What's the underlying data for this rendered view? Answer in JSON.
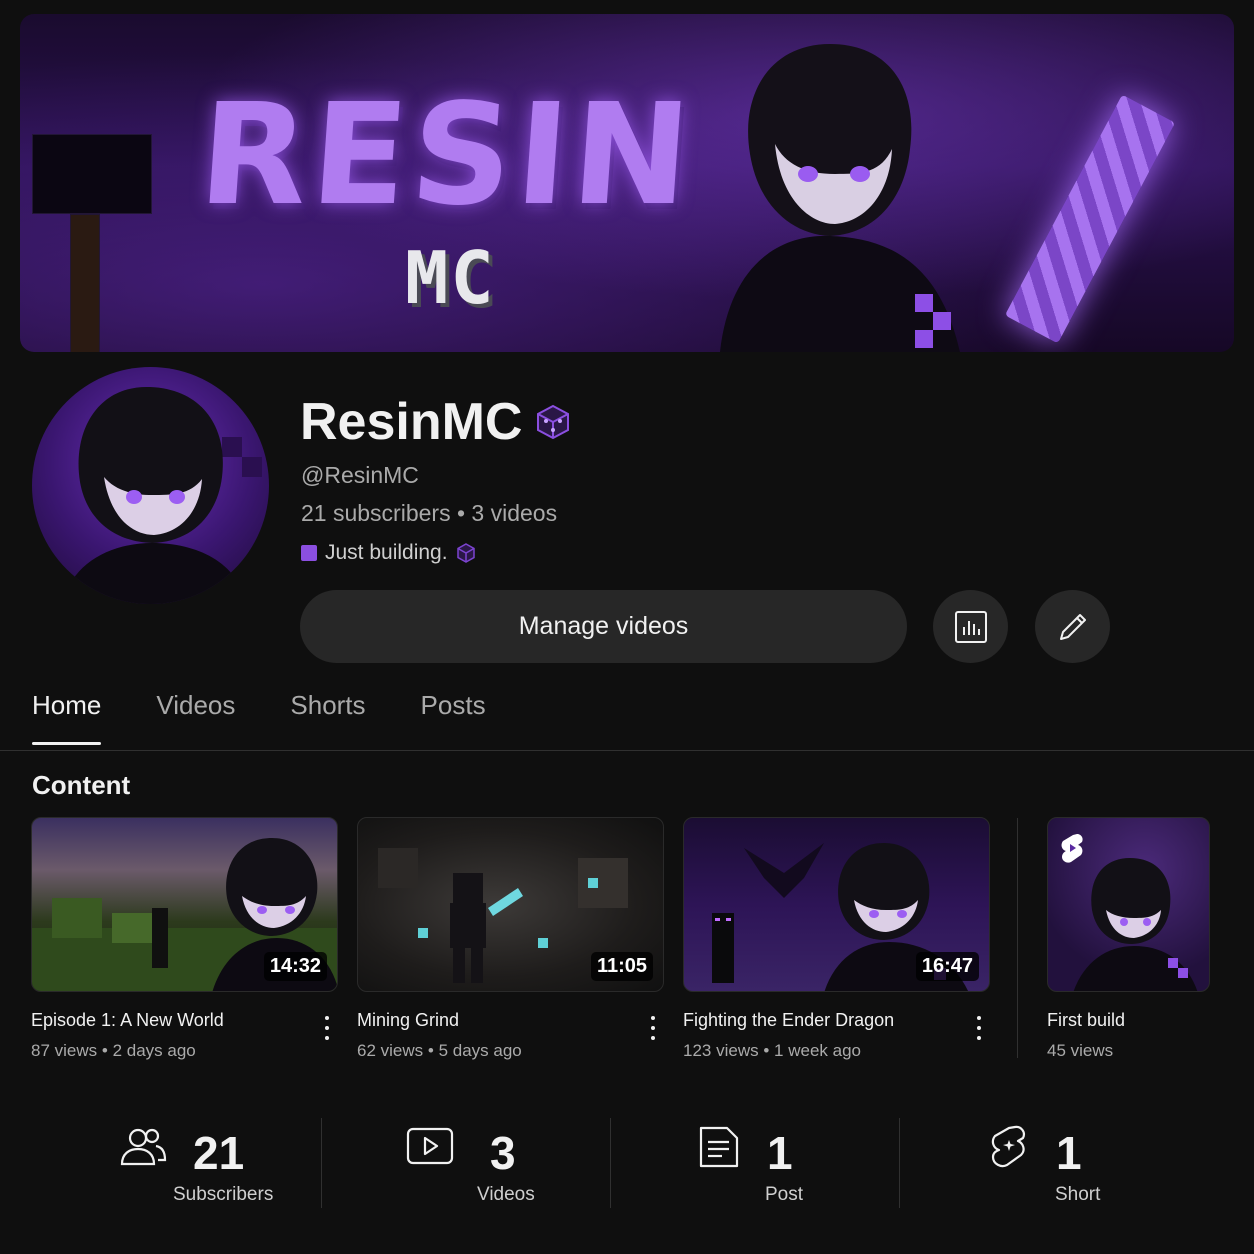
{
  "banner": {
    "title": "RESIN",
    "subtitle": "MC"
  },
  "channel": {
    "name": "ResinMC",
    "handle": "@ResinMC",
    "subscribers_text": "21 subscribers",
    "videos_text": "3 videos",
    "bio": "Just building.",
    "accent": "#8b4fe0"
  },
  "actions": {
    "manage_label": "Manage videos"
  },
  "tabs": [
    {
      "label": "Home",
      "active": true
    },
    {
      "label": "Videos",
      "active": false
    },
    {
      "label": "Shorts",
      "active": false
    },
    {
      "label": "Posts",
      "active": false
    }
  ],
  "content": {
    "title": "Content",
    "videos": [
      {
        "title": "Episode 1: A New World",
        "views": "87 views",
        "age": "2 days ago",
        "duration": "14:32"
      },
      {
        "title": "Mining Grind",
        "views": "62 views",
        "age": "5 days ago",
        "duration": "11:05"
      },
      {
        "title": "Fighting the Ender Dragon",
        "views": "123 views",
        "age": "1 week ago",
        "duration": "16:47"
      }
    ],
    "short": {
      "title": "First build",
      "views": "45 views",
      "icon": "shorts-icon"
    }
  },
  "summary": [
    {
      "value": "21",
      "label": "Subscribers",
      "icon": "people-icon"
    },
    {
      "value": "3",
      "label": "Videos",
      "icon": "play-icon"
    },
    {
      "value": "1",
      "label": "Post",
      "icon": "post-icon"
    },
    {
      "value": "1",
      "label": "Short",
      "icon": "shorts-icon"
    }
  ]
}
